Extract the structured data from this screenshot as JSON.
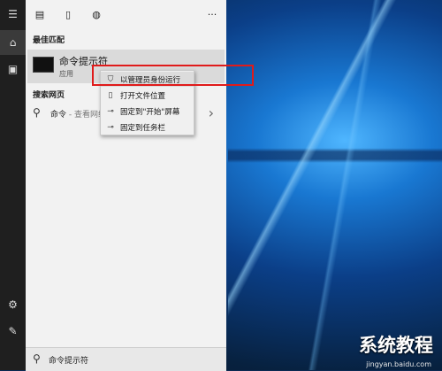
{
  "panel": {
    "best_match_label": "最佳匹配",
    "best_match_title": "命令提示符",
    "best_match_subtitle": "应用",
    "web_section_label": "搜索网页",
    "web_query": "命令",
    "web_hint": " - 查看网络",
    "more_label": "···"
  },
  "context_menu": {
    "items": [
      {
        "label": "以管理员身份运行",
        "icon": "shield-icon"
      },
      {
        "label": "打开文件位置",
        "icon": "file-location-icon"
      },
      {
        "label": "固定到\"开始\"屏幕",
        "icon": "pin-icon"
      },
      {
        "label": "固定到任务栏",
        "icon": "pin-icon"
      }
    ]
  },
  "search": {
    "value": "命令提示符"
  },
  "watermark": {
    "text": "系统教程",
    "subtext": "jingyan.baidu.com"
  },
  "colors": {
    "highlight": "#e01b1b",
    "rail": "#1f1f1f",
    "panel": "#f2f2f2"
  }
}
